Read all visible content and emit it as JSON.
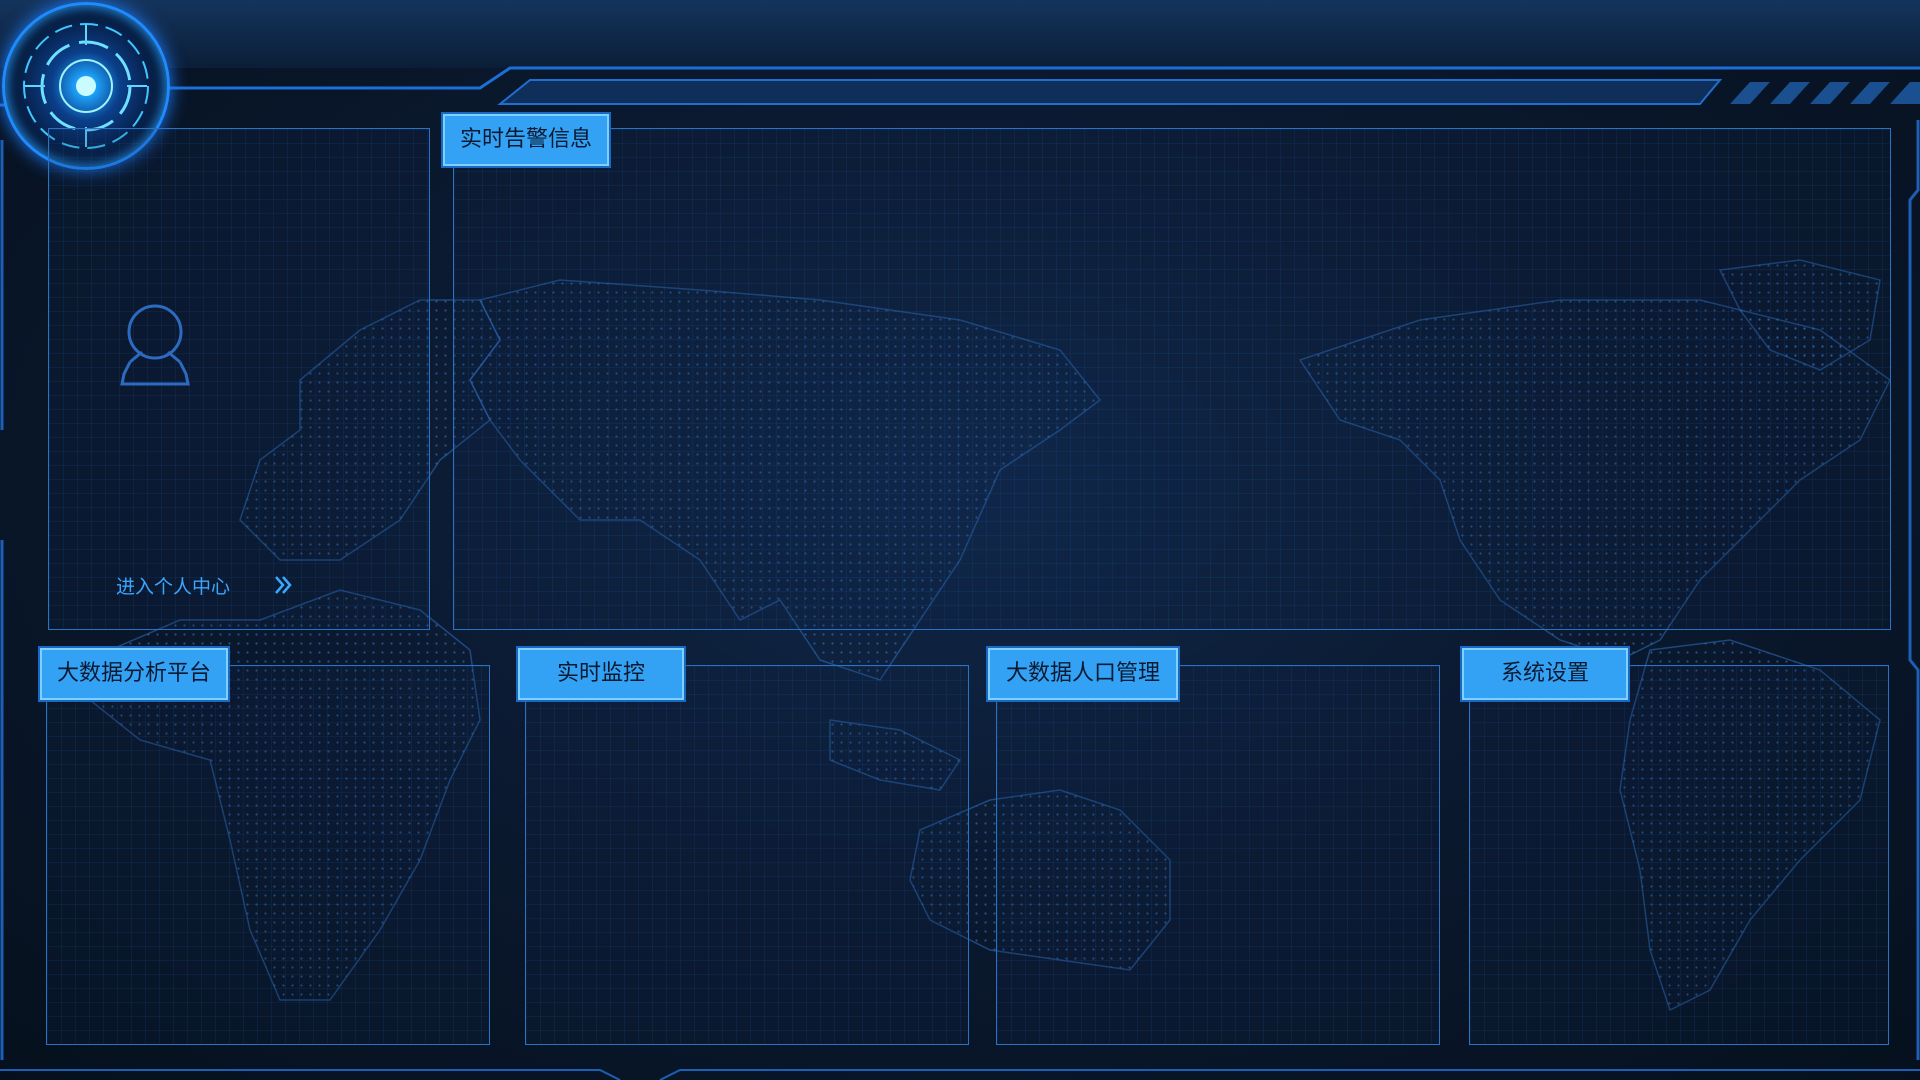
{
  "icons": {
    "logo": "radar-logo-icon",
    "avatar": "user-avatar-icon",
    "enter": "double-chevron-right-icon"
  },
  "colors": {
    "background": "#0b1a31",
    "panel_border": "#2a72c4",
    "title_fill": "#33a2f5",
    "accent": "#3aa7ff"
  },
  "user_panel": {
    "enter_label": "进入个人中心"
  },
  "alert_panel": {
    "title": "实时告警信息"
  },
  "modules": [
    {
      "title": "大数据分析平台"
    },
    {
      "title": "实时监控"
    },
    {
      "title": "大数据人口管理"
    },
    {
      "title": "系统设置"
    }
  ]
}
